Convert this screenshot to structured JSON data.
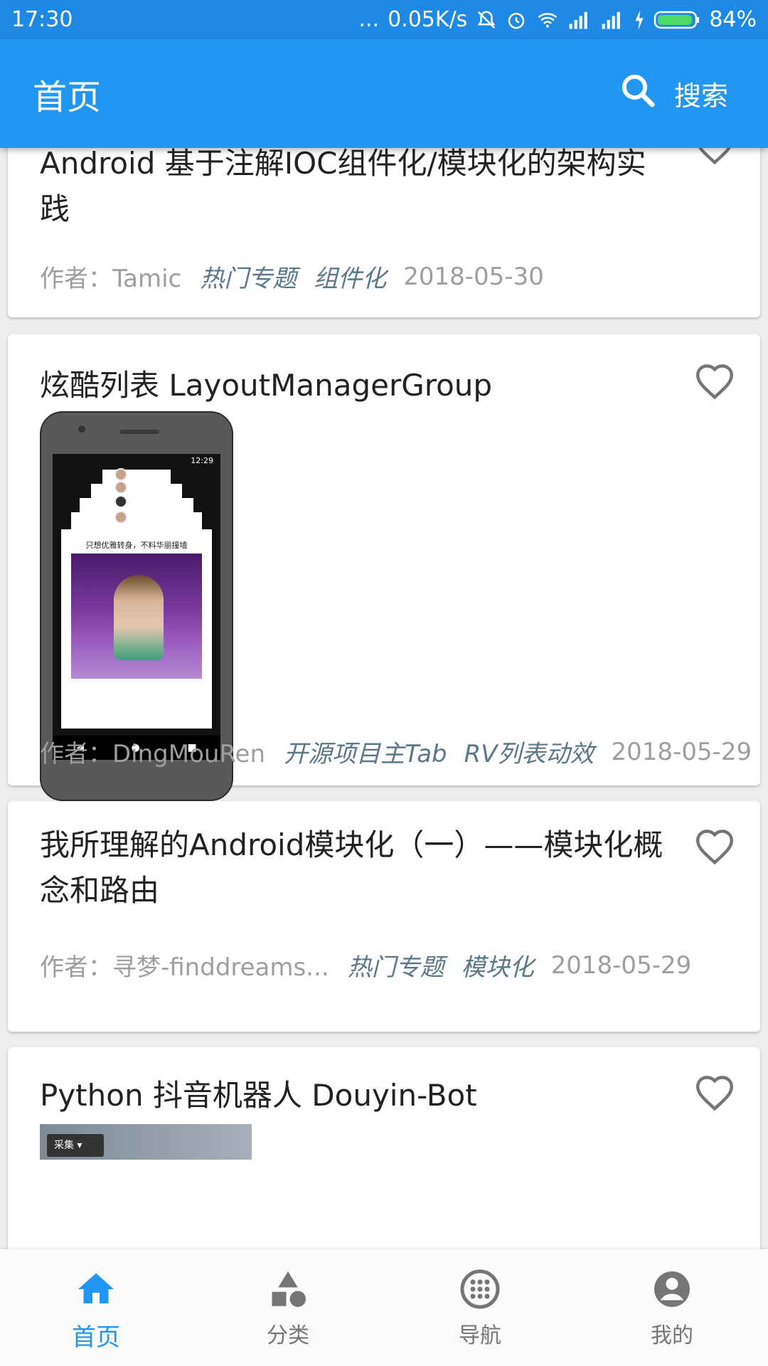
{
  "status_bar": {
    "time": "17:30",
    "dots": "...",
    "speed": "0.05K/s",
    "battery": "84%"
  },
  "app_bar": {
    "title": "首页",
    "search_label": "搜索"
  },
  "articles": [
    {
      "title": "Android 基于注解IOC组件化/模块化的架构实践",
      "author": "作者：Tamic",
      "tags": [
        "热门专题",
        "组件化"
      ],
      "date": "2018-05-30"
    },
    {
      "title": "炫酷列表 LayoutManagerGroup",
      "author": "作者：DingMouRen",
      "tags": [
        "开源项目主Tab",
        "RV列表动效"
      ],
      "date": "2018-05-29",
      "preview": {
        "clock": "12:29",
        "caption": "只想优雅转身，不料华丽撞墙"
      }
    },
    {
      "title": "我所理解的Android模块化（一）——模块化概念和路由",
      "author": "作者：寻梦-finddreams...",
      "tags": [
        "热门专题",
        "模块化"
      ],
      "date": "2018-05-29"
    },
    {
      "title": "Python 抖音机器人 Douyin-Bot",
      "preview": {
        "chip": "采集"
      }
    }
  ],
  "bottom_nav": [
    {
      "label": "首页",
      "icon": "home-icon",
      "active": true
    },
    {
      "label": "分类",
      "icon": "category-icon",
      "active": false
    },
    {
      "label": "导航",
      "icon": "navigation-icon",
      "active": false
    },
    {
      "label": "我的",
      "icon": "account-icon",
      "active": false
    }
  ],
  "colors": {
    "primary": "#2196f3",
    "status_bar": "#1e88e5",
    "tag": "#5a7887",
    "meta": "#9e9e9e"
  }
}
